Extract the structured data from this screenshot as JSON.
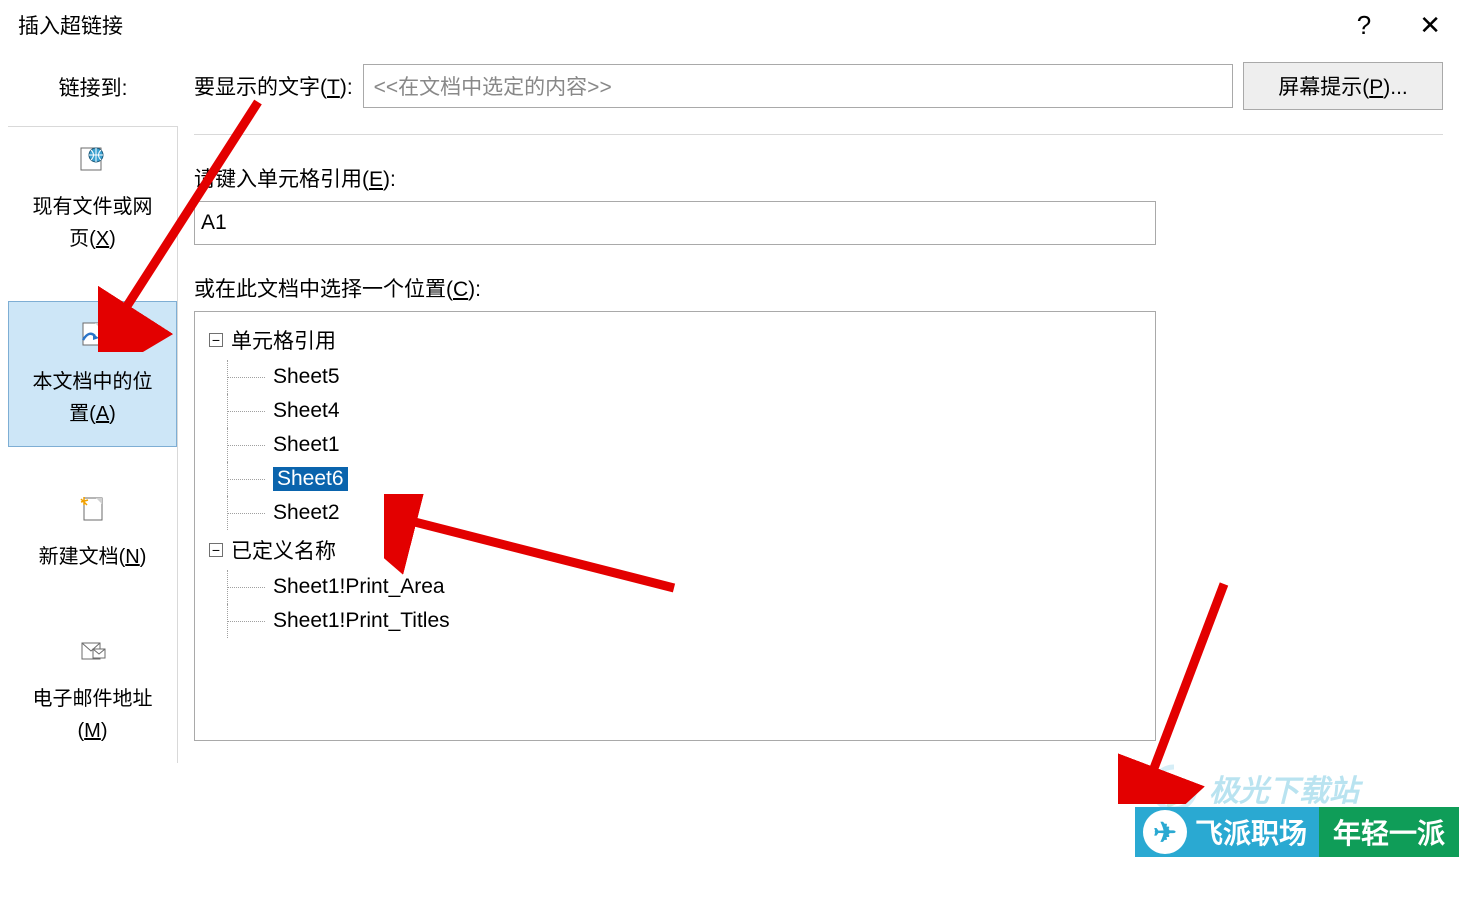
{
  "dialog": {
    "title": "插入超链接",
    "help_icon": "?",
    "close_icon": "✕"
  },
  "sidebar": {
    "label": "链接到:",
    "items": [
      {
        "line1": "现有文件或网",
        "line2": "页(",
        "key": "X",
        "line3": ")"
      },
      {
        "line1": "本文档中的位",
        "line2": "置(",
        "key": "A",
        "line3": ")"
      },
      {
        "line1": "新建文档(",
        "key": "N",
        "line2": ")"
      },
      {
        "line1": "电子邮件地址",
        "line2": "(",
        "key": "M",
        "line3": ")"
      }
    ]
  },
  "display": {
    "label_pre": "要显示的文字(",
    "label_key": "T",
    "label_post": "):",
    "value": "<<在文档中选定的内容>>",
    "screentip_pre": "屏幕提示(",
    "screentip_key": "P",
    "screentip_post": ")..."
  },
  "cellref": {
    "label_pre": "请键入单元格引用(",
    "label_key": "E",
    "label_post": "):",
    "value": "A1"
  },
  "location": {
    "label_pre": "或在此文档中选择一个位置(",
    "label_key": "C",
    "label_post": "):"
  },
  "tree": {
    "group1": {
      "label": "单元格引用",
      "expander": "−"
    },
    "sheets": [
      "Sheet5",
      "Sheet4",
      "Sheet1",
      "Sheet6",
      "Sheet2"
    ],
    "selected": "Sheet6",
    "group2": {
      "label": "已定义名称",
      "expander": "−"
    },
    "names": [
      "Sheet1!Print_Area",
      "Sheet1!Print_Titles"
    ]
  },
  "watermark": {
    "logo_text": "极光下载站",
    "banner_seg1": "飞派职场",
    "banner_seg2": "年轻一派"
  }
}
